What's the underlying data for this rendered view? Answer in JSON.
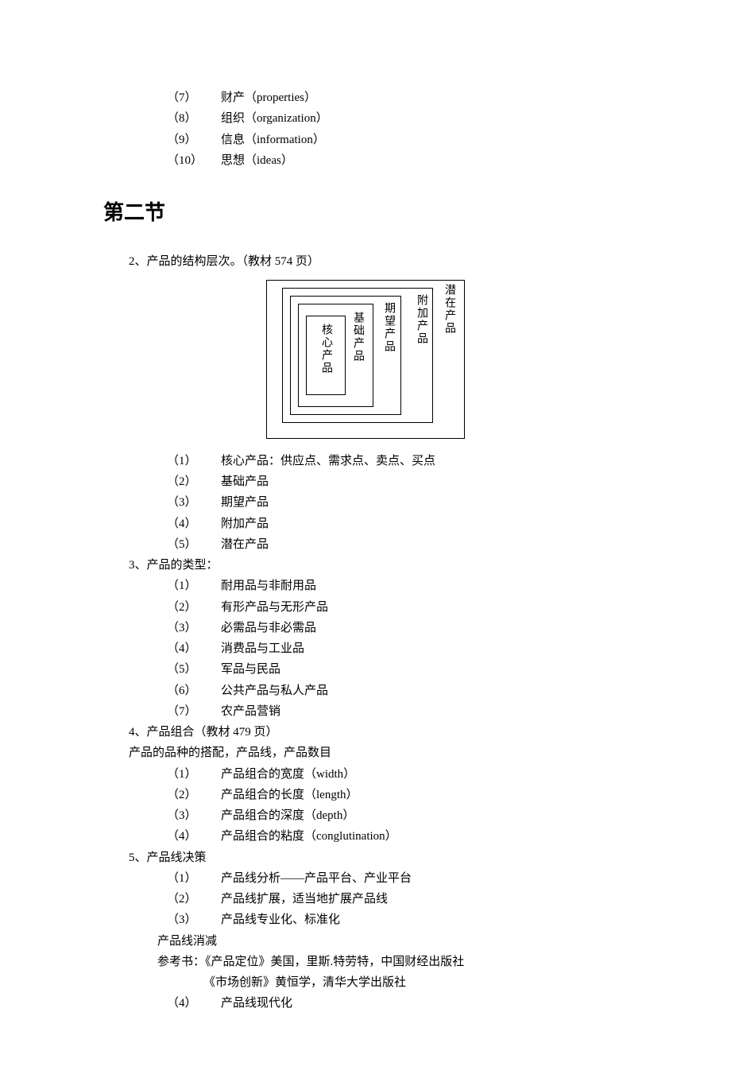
{
  "top_items": [
    {
      "num": "（7）",
      "text": "财产（properties）"
    },
    {
      "num": "（8）",
      "text": "组织（organization）"
    },
    {
      "num": "（9）",
      "text": "信息（information）"
    },
    {
      "num": "（10）",
      "text": "思想（ideas）"
    }
  ],
  "section_title": "第二节",
  "p2": {
    "heading": "2、产品的结构层次。（教材 574 页）",
    "diagram_labels": {
      "l1": "核心产品",
      "l2": "基础产品",
      "l3": "期望产品",
      "l4": "附加产品",
      "l5": "潜在产品"
    },
    "items": [
      {
        "num": "（1）",
        "text": "核心产品：供应点、需求点、卖点、买点"
      },
      {
        "num": "（2）",
        "text": "基础产品"
      },
      {
        "num": "（3）",
        "text": "期望产品"
      },
      {
        "num": "（4）",
        "text": "附加产品"
      },
      {
        "num": "（5）",
        "text": "潜在产品"
      }
    ]
  },
  "p3": {
    "heading": "3、产品的类型：",
    "items": [
      {
        "num": "（1）",
        "text": "耐用品与非耐用品"
      },
      {
        "num": "（2）",
        "text": "有形产品与无形产品"
      },
      {
        "num": "（3）",
        "text": "必需品与非必需品"
      },
      {
        "num": "（4）",
        "text": "消费品与工业品"
      },
      {
        "num": "（5）",
        "text": "军品与民品"
      },
      {
        "num": "（6）",
        "text": "公共产品与私人产品"
      },
      {
        "num": "（7）",
        "text": "农产品营销"
      }
    ]
  },
  "p4": {
    "heading": "4、产品组合（教材 479 页）",
    "sub": "产品的品种的搭配，产品线，产品数目",
    "items": [
      {
        "num": "（1）",
        "text": "产品组合的宽度（width）"
      },
      {
        "num": "（2）",
        "text": "产品组合的长度（length）"
      },
      {
        "num": "（3）",
        "text": "产品组合的深度（depth）"
      },
      {
        "num": "（4）",
        "text": "产品组合的粘度（conglutination）"
      }
    ]
  },
  "p5": {
    "heading": "5、产品线决策",
    "items_a": [
      {
        "num": "（1）",
        "text": "产品线分析——产品平台、产业平台"
      },
      {
        "num": "（2）",
        "text": "产品线扩展，适当地扩展产品线"
      },
      {
        "num": "（3）",
        "text": "产品线专业化、标准化"
      }
    ],
    "note1": "产品线消减",
    "note2": "参考书：《产品定位》美国，里斯.特劳特，中国财经出版社",
    "note3": "《市场创新》黄恒学，清华大学出版社",
    "items_b": [
      {
        "num": "（4）",
        "text": "产品线现代化"
      }
    ]
  }
}
